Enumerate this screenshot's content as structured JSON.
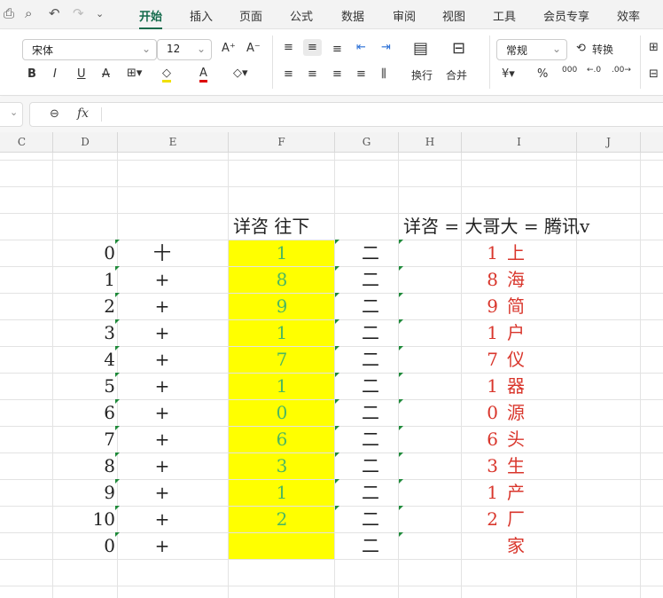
{
  "toolbar": {
    "tabs": [
      "开始",
      "插入",
      "页面",
      "公式",
      "数据",
      "审阅",
      "视图",
      "工具",
      "会员专享",
      "效率"
    ],
    "font_name": "宋体",
    "font_size": "12",
    "number_format": "常规",
    "convert": "转换",
    "wrap": "换行",
    "merge": "合并"
  },
  "formula_bar": {
    "fx": "fx",
    "value": ""
  },
  "columns": [
    "C",
    "D",
    "E",
    "F",
    "G",
    "H",
    "I",
    "J"
  ],
  "headers": {
    "f": "详咨 往下",
    "h": "详咨 = 大哥大 = 腾讯v"
  },
  "rows": [
    {
      "d": "0",
      "e": "十",
      "f": "1",
      "g": "二",
      "i_num": "1",
      "i_char": "上"
    },
    {
      "d": "1",
      "e": "+",
      "f": "8",
      "g": "二",
      "i_num": "8",
      "i_char": "海"
    },
    {
      "d": "2",
      "e": "+",
      "f": "9",
      "g": "二",
      "i_num": "9",
      "i_char": "简"
    },
    {
      "d": "3",
      "e": "+",
      "f": "1",
      "g": "二",
      "i_num": "1",
      "i_char": "户"
    },
    {
      "d": "4",
      "e": "+",
      "f": "7",
      "g": "二",
      "i_num": "7",
      "i_char": "仪"
    },
    {
      "d": "5",
      "e": "+",
      "f": "1",
      "g": "二",
      "i_num": "1",
      "i_char": "器"
    },
    {
      "d": "6",
      "e": "+",
      "f": "0",
      "g": "二",
      "i_num": "0",
      "i_char": "源"
    },
    {
      "d": "7",
      "e": "+",
      "f": "6",
      "g": "二",
      "i_num": "6",
      "i_char": "头"
    },
    {
      "d": "8",
      "e": "+",
      "f": "3",
      "g": "二",
      "i_num": "3",
      "i_char": "生"
    },
    {
      "d": "9",
      "e": "+",
      "f": "1",
      "g": "二",
      "i_num": "1",
      "i_char": "产"
    },
    {
      "d": "10",
      "e": "+",
      "f": "2",
      "g": "二",
      "i_num": "2",
      "i_char": "厂"
    },
    {
      "d": "0",
      "e": "+",
      "f": "",
      "g": "二",
      "i_num": "",
      "i_char": "家"
    }
  ],
  "colors": {
    "green_text": "#4cb860",
    "red_text": "#d9362c",
    "fill": "#ffff00",
    "accent": "#146b4c"
  }
}
